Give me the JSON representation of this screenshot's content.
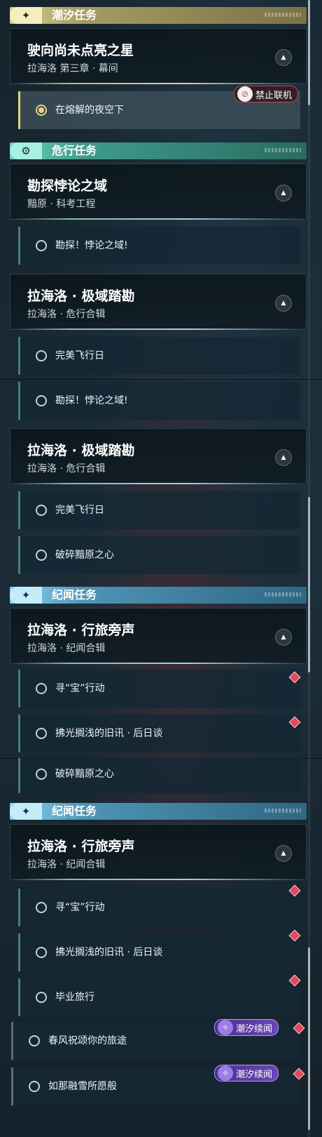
{
  "panel1": {
    "cat_tide": {
      "label": "潮汐任务"
    },
    "card_main": {
      "title": "驶向尚未点亮之星",
      "sub": "拉海洛 第三章 · 幕间"
    },
    "task_active": {
      "label": "在熔解的夜空下",
      "badge": "禁止联机"
    },
    "cat_danger": {
      "label": "危行任务"
    },
    "card_danger1": {
      "title": "勘探悖论之域",
      "sub": "黯原 · 科考工程"
    },
    "task_d1": {
      "label": "勘探！悖论之域!"
    },
    "card_danger2": {
      "title": "拉海洛 · 极域踏勘",
      "sub": "拉海洛 · 危行合辑"
    },
    "task_d2": {
      "label": "完美飞行日"
    }
  },
  "panel2": {
    "task_a": {
      "label": "勘探！悖论之域!"
    },
    "card_danger2": {
      "title": "拉海洛 · 极域踏勘",
      "sub": "拉海洛 · 危行合辑"
    },
    "task_b": {
      "label": "完美飞行日"
    },
    "task_c": {
      "label": "破碎黯原之心"
    },
    "cat_story": {
      "label": "纪闻任务"
    },
    "card_story": {
      "title": "拉海洛 · 行旅旁声",
      "sub": "拉海洛 · 纪闻合辑"
    },
    "task_d": {
      "label": "寻“宝”行动"
    },
    "task_e": {
      "label": "拂光搁浅的旧讯 · 后日谈"
    }
  },
  "panel3": {
    "task_a": {
      "label": "破碎黯原之心"
    },
    "cat_story": {
      "label": "纪闻任务"
    },
    "card_story": {
      "title": "拉海洛 · 行旅旁声",
      "sub": "拉海洛 · 纪闻合辑"
    },
    "task_b": {
      "label": "寻“宝”行动"
    },
    "task_c": {
      "label": "拂光搁浅的旧讯 · 后日谈"
    },
    "task_d": {
      "label": "毕业旅行"
    },
    "task_e": {
      "label": "春风祝颂你的旅途",
      "badge": "潮汐续闻"
    },
    "task_f": {
      "label": "如那融雪所愿般",
      "badge": "潮汐续闻"
    }
  },
  "icons": {
    "tide_badge": "four-point-star-icon",
    "danger_badge": "gear-icon",
    "story_badge": "four-point-star-icon",
    "toggle": "chevron-up-icon",
    "alert": "red-diamond-icon",
    "offline": "no-multiplayer-icon",
    "tide_followup": "spiral-star-icon"
  },
  "colors": {
    "tide": "#d6ce93",
    "danger": "#6fd2bd",
    "story": "#8fd5f0",
    "alert": "#e04a5a",
    "followup": "#6a47b8"
  }
}
